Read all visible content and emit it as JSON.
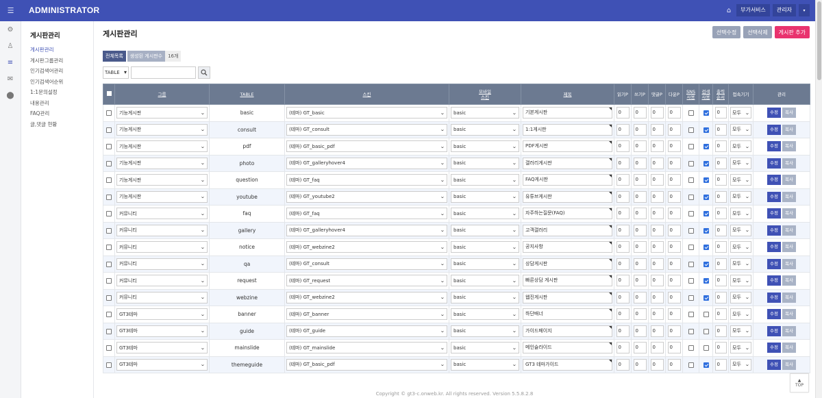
{
  "topbar": {
    "brand": "ADMINISTRATOR",
    "menu_icon": "☰",
    "home_icon": "⌂",
    "extra_services": "부가서비스",
    "admin_label": "관리자",
    "caret": "▾"
  },
  "rail": {
    "icons": [
      "⚙",
      "♙",
      "≡",
      "✉",
      "⬤"
    ]
  },
  "sidebar": {
    "title": "게시판관리",
    "items": [
      "게시판관리",
      "게시판그룹관리",
      "인기검색어관리",
      "인기검색어순위",
      "1:1문의설정",
      "내용관리",
      "FAQ관리",
      "글,댓글 현황"
    ]
  },
  "main": {
    "title": "게시판관리",
    "btn_edit_selected": "선택수정",
    "btn_delete_selected": "선택삭제",
    "btn_add_board": "게시판 추가",
    "filter_all": "전체목록",
    "filter_created": "생성된 게시판수",
    "filter_count": "16개",
    "search_select": "TABLE",
    "search_placeholder": "",
    "search_icon": "⌕"
  },
  "table": {
    "headers": {
      "group": "그룹",
      "table": "TABLE",
      "skin": "스킨",
      "mobile_skin_1": "모바일",
      "mobile_skin_2": "스킨",
      "subject": "제목",
      "read": "읽기P",
      "write": "쓰기P",
      "comment": "댓글P",
      "download": "다운P",
      "sns_1": "SNS",
      "sns_2": "사용",
      "search_1": "검색",
      "search_2": "사용",
      "order_1": "출력",
      "order_2": "순서",
      "access": "접속기기",
      "manage": "관리"
    },
    "rows": [
      {
        "group": "기능게시판",
        "table": "basic",
        "skin": "(테마) GT_basic",
        "mskin": "basic",
        "subject": "기본게시판",
        "read": "0",
        "write": "0",
        "comment": "0",
        "download": "0",
        "sns": false,
        "search": true,
        "order": "0",
        "access": "모두"
      },
      {
        "group": "기능게시판",
        "table": "consult",
        "skin": "(테마) GT_consult",
        "mskin": "basic",
        "subject": "1:1게시판",
        "read": "0",
        "write": "0",
        "comment": "0",
        "download": "0",
        "sns": false,
        "search": true,
        "order": "0",
        "access": "모두"
      },
      {
        "group": "기능게시판",
        "table": "pdf",
        "skin": "(테마) GT_basic_pdf",
        "mskin": "basic",
        "subject": "PDF게시판",
        "read": "0",
        "write": "0",
        "comment": "0",
        "download": "0",
        "sns": false,
        "search": true,
        "order": "0",
        "access": "모두"
      },
      {
        "group": "기능게시판",
        "table": "photo",
        "skin": "(테마) GT_galleryhover4",
        "mskin": "basic",
        "subject": "갤러리게시판",
        "read": "0",
        "write": "0",
        "comment": "0",
        "download": "0",
        "sns": false,
        "search": true,
        "order": "0",
        "access": "모두"
      },
      {
        "group": "기능게시판",
        "table": "question",
        "skin": "(테마) GT_faq",
        "mskin": "basic",
        "subject": "FAQ게시판",
        "read": "0",
        "write": "0",
        "comment": "0",
        "download": "0",
        "sns": false,
        "search": true,
        "order": "0",
        "access": "모두"
      },
      {
        "group": "기능게시판",
        "table": "youtube",
        "skin": "(테마) GT_youtube2",
        "mskin": "basic",
        "subject": "유튜브게시판",
        "read": "0",
        "write": "0",
        "comment": "0",
        "download": "0",
        "sns": false,
        "search": true,
        "order": "0",
        "access": "모두"
      },
      {
        "group": "커뮤니티",
        "table": "faq",
        "skin": "(테마) GT_faq",
        "mskin": "basic",
        "subject": "자주하는질문(FAQ)",
        "read": "0",
        "write": "0",
        "comment": "0",
        "download": "0",
        "sns": false,
        "search": true,
        "order": "0",
        "access": "모두"
      },
      {
        "group": "커뮤니티",
        "table": "gallery",
        "skin": "(테마) GT_galleryhover4",
        "mskin": "basic",
        "subject": "고객갤러리",
        "read": "0",
        "write": "0",
        "comment": "0",
        "download": "0",
        "sns": false,
        "search": true,
        "order": "0",
        "access": "모두"
      },
      {
        "group": "커뮤니티",
        "table": "notice",
        "skin": "(테마) GT_webzine2",
        "mskin": "basic",
        "subject": "공지사항",
        "read": "0",
        "write": "0",
        "comment": "0",
        "download": "0",
        "sns": false,
        "search": true,
        "order": "0",
        "access": "모두"
      },
      {
        "group": "커뮤니티",
        "table": "qa",
        "skin": "(테마) GT_consult",
        "mskin": "basic",
        "subject": "상담게시판",
        "read": "0",
        "write": "0",
        "comment": "0",
        "download": "0",
        "sns": false,
        "search": true,
        "order": "0",
        "access": "모두"
      },
      {
        "group": "커뮤니티",
        "table": "request",
        "skin": "(테마) GT_request",
        "mskin": "basic",
        "subject": "빠른상담 게시판",
        "read": "0",
        "write": "0",
        "comment": "0",
        "download": "0",
        "sns": false,
        "search": true,
        "order": "0",
        "access": "모두"
      },
      {
        "group": "커뮤니티",
        "table": "webzine",
        "skin": "(테마) GT_webzine2",
        "mskin": "basic",
        "subject": "웹진게시판",
        "read": "0",
        "write": "0",
        "comment": "0",
        "download": "0",
        "sns": false,
        "search": true,
        "order": "0",
        "access": "모두"
      },
      {
        "group": "GT3테마",
        "table": "banner",
        "skin": "(테마) GT_banner",
        "mskin": "basic",
        "subject": "하단배너",
        "read": "0",
        "write": "0",
        "comment": "0",
        "download": "0",
        "sns": false,
        "search": false,
        "order": "0",
        "access": "모두"
      },
      {
        "group": "GT3테마",
        "table": "guide",
        "skin": "(테마) GT_guide",
        "mskin": "basic",
        "subject": "가이드페이지",
        "read": "0",
        "write": "0",
        "comment": "0",
        "download": "0",
        "sns": false,
        "search": false,
        "order": "0",
        "access": "모두"
      },
      {
        "group": "GT3테마",
        "table": "mainslide",
        "skin": "(테마) GT_mainslide",
        "mskin": "basic",
        "subject": "메인슬라이드",
        "read": "0",
        "write": "0",
        "comment": "0",
        "download": "0",
        "sns": false,
        "search": false,
        "order": "0",
        "access": "모두"
      },
      {
        "group": "GT3테마",
        "table": "themeguide",
        "skin": "(테마) GT_basic_pdf",
        "mskin": "basic",
        "subject": "GT3 테마가이드",
        "read": "0",
        "write": "0",
        "comment": "0",
        "download": "0",
        "sns": false,
        "search": true,
        "order": "0",
        "access": "모두"
      }
    ],
    "btn_edit": "수정",
    "btn_copy": "복사"
  },
  "footer": {
    "copyright": "Copyright © gt3-c.onweb.kr. All rights reserved. Version 5.5.8.2.8"
  },
  "top_button": {
    "arrow": "▲",
    "label": "TOP"
  },
  "colors": {
    "primary": "#3f51b5",
    "pink": "#e9336e",
    "header_bg": "#6c7a91"
  }
}
